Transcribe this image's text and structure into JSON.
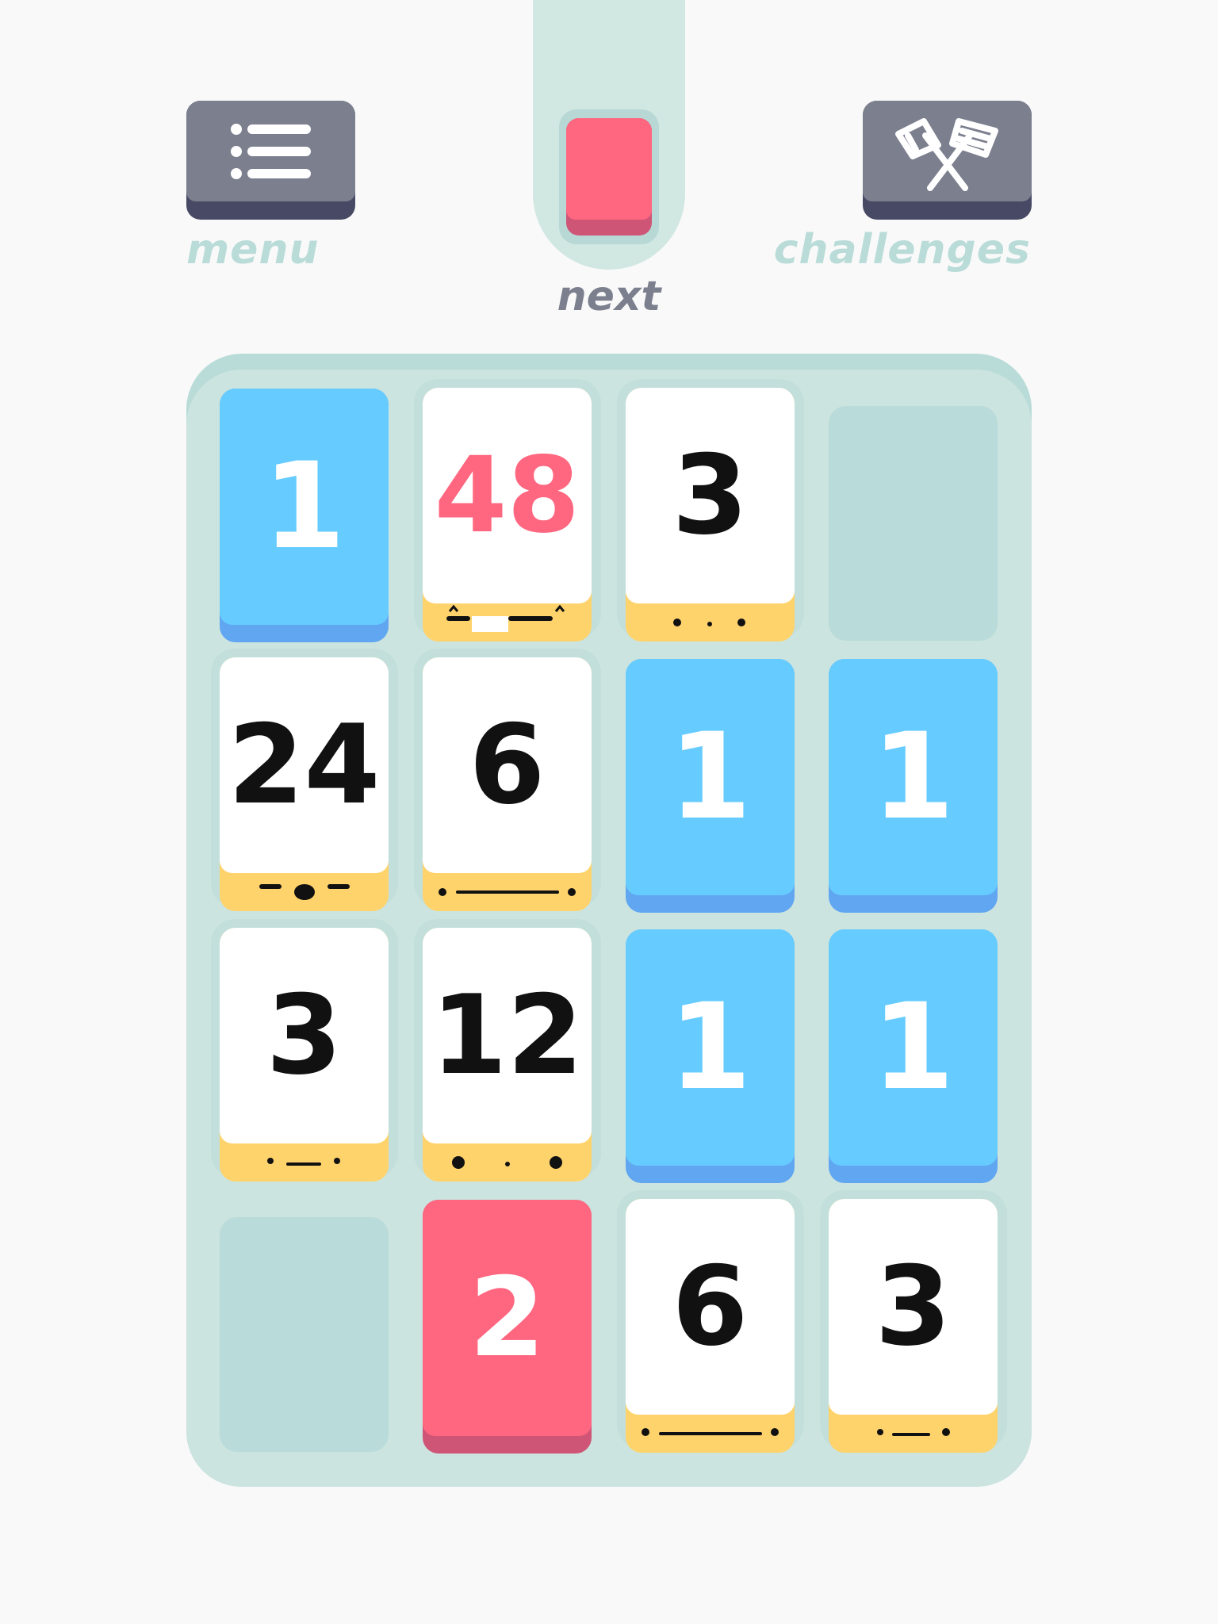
{
  "colors": {
    "background": "#f9f9f9",
    "board": "#cce4df",
    "blue_tile": "#66ccff",
    "red_tile": "#ff6680",
    "white_tile": "#ffffff",
    "tile_base_yellow": "#ffd36b",
    "button": "#7b7f8e",
    "label_teal": "#b9dcd8",
    "label_gray": "#7b7f8e"
  },
  "header": {
    "menu": {
      "label": "menu",
      "icon": "list-icon"
    },
    "next": {
      "label": "next",
      "card_color": "red"
    },
    "challenges": {
      "label": "challenges",
      "icon": "crossed-flags-icon"
    }
  },
  "board": {
    "rows": [
      [
        {
          "value": "1",
          "color": "blue"
        },
        {
          "value": "48",
          "color": "white"
        },
        {
          "value": "3",
          "color": "white"
        },
        {
          "value": "",
          "color": "empty"
        }
      ],
      [
        {
          "value": "24",
          "color": "white"
        },
        {
          "value": "6",
          "color": "white"
        },
        {
          "value": "1",
          "color": "blue"
        },
        {
          "value": "1",
          "color": "blue"
        }
      ],
      [
        {
          "value": "3",
          "color": "white"
        },
        {
          "value": "12",
          "color": "white"
        },
        {
          "value": "1",
          "color": "blue"
        },
        {
          "value": "1",
          "color": "blue"
        }
      ],
      [
        {
          "value": "",
          "color": "empty"
        },
        {
          "value": "2",
          "color": "red"
        },
        {
          "value": "6",
          "color": "white"
        },
        {
          "value": "3",
          "color": "white"
        }
      ]
    ]
  }
}
